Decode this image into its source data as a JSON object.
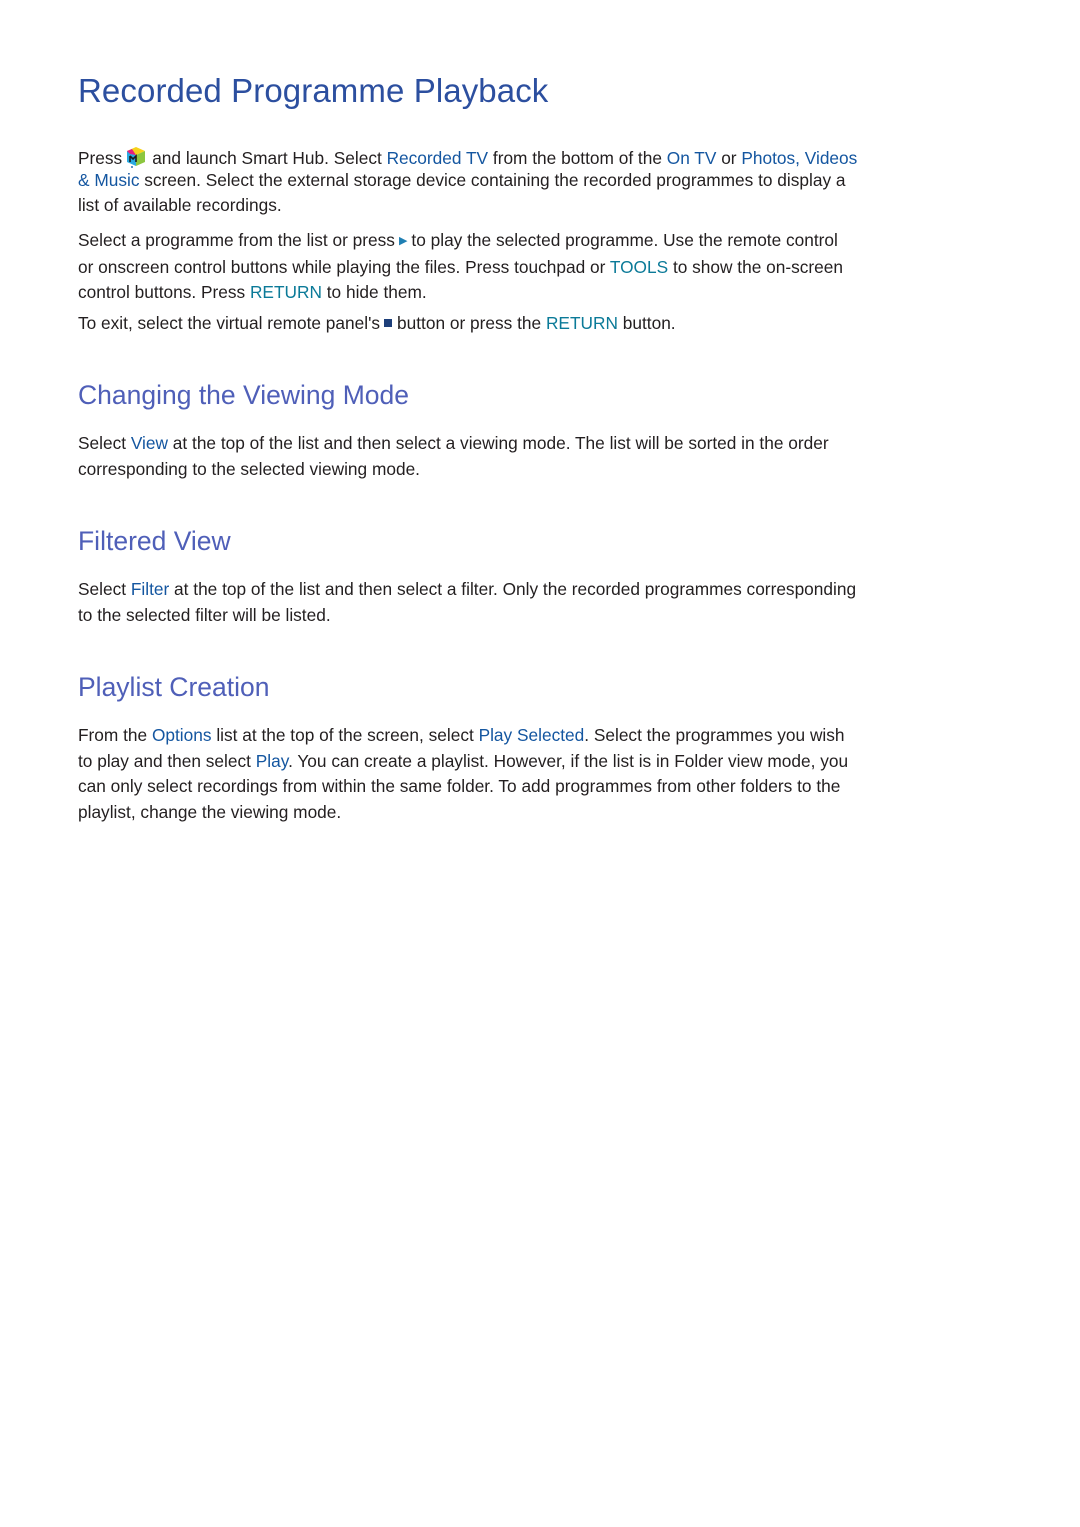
{
  "title": "Recorded Programme Playback",
  "intro": {
    "p1": {
      "l1_a": "Press",
      "icon": "smart-hub-icon",
      "l1_b": "and launch Smart Hub. Select ",
      "l1_recorded_tv": "Recorded TV",
      "l1_c": " from the bottom of the ",
      "l1_on_tv": "On TV",
      "l1_d": " or ",
      "l1_photos": "Photos, Videos",
      "l2_music": "& Music",
      "l2_a": " screen. Select the external storage device containing the recorded programmes to display a",
      "l3": "list of available recordings."
    },
    "p2": {
      "l1_a": "Select a programme from the list or press",
      "play_icon": "play-icon",
      "l1_b": "to play the selected programme. Use the remote control",
      "l2_a": "or onscreen control buttons while playing the files. Press touchpad or ",
      "l2_tools": "TOOLS",
      "l2_b": " to show the on-screen",
      "l3_a": "control buttons. Press ",
      "l3_return": "RETURN",
      "l3_b": " to hide them."
    },
    "p3": {
      "a": "To exit, select the virtual remote panel's",
      "stop_icon": "stop-icon",
      "b": "button or press the ",
      "return": "RETURN",
      "c": " button."
    }
  },
  "sections": [
    {
      "heading": "Changing the Viewing Mode",
      "l1_a": "Select ",
      "l1_link": "View",
      "l1_b": " at the top of the list and then select a viewing mode. The list will be sorted in the order",
      "l2": "corresponding to the selected viewing mode."
    },
    {
      "heading": "Filtered View",
      "l1_a": "Select ",
      "l1_link": "Filter",
      "l1_b": " at the top of the list and then select a filter. Only the recorded programmes corresponding",
      "l2": "to the selected filter will be listed."
    },
    {
      "heading": "Playlist Creation",
      "l1_a": "From the ",
      "l1_options": "Options",
      "l1_b": " list at the top of the screen, select ",
      "l1_play_selected": "Play Selected",
      "l1_c": ". Select the programmes you wish",
      "l2_a": "to play and then select ",
      "l2_play": "Play",
      "l2_b": ". You can create a playlist. However, if the list is in Folder view mode, you",
      "l3": "can only select recordings from within the same folder. To add programmes from other folders to the",
      "l4": "playlist, change the viewing mode."
    }
  ],
  "colors": {
    "title": "#2c4f9f",
    "heading": "#4f5fb8",
    "menu_link": "#1456a0",
    "button_name": "#0b7a98",
    "body_text": "#231f20"
  }
}
